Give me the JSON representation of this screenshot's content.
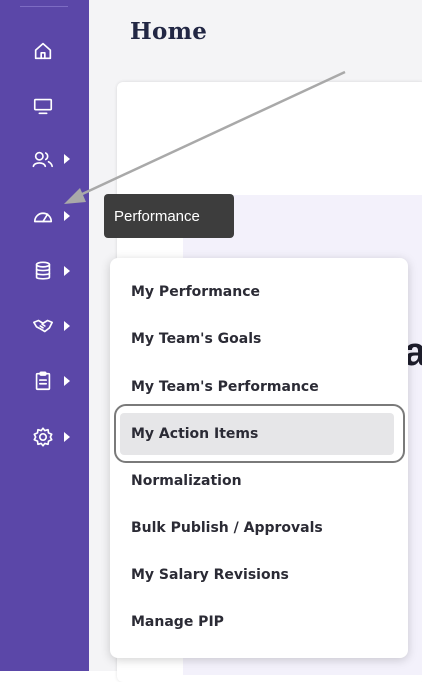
{
  "header": {
    "title": "Home"
  },
  "sidebar": {
    "items": [
      {
        "icon": "home-icon",
        "has_submenu": false
      },
      {
        "icon": "monitor-icon",
        "has_submenu": false
      },
      {
        "icon": "users-icon",
        "has_submenu": true
      },
      {
        "icon": "speedometer-icon",
        "has_submenu": true
      },
      {
        "icon": "database-icon",
        "has_submenu": true
      },
      {
        "icon": "handshake-icon",
        "has_submenu": true
      },
      {
        "icon": "clipboard-icon",
        "has_submenu": true
      },
      {
        "icon": "gear-icon",
        "has_submenu": true
      }
    ]
  },
  "tooltip": {
    "label": "Performance"
  },
  "submenu": {
    "items": [
      "My Performance",
      "My Team's Goals",
      "My Team's Performance",
      "My Action Items",
      "Normalization",
      "Bulk Publish / Approvals",
      "My Salary Revisions",
      "Manage PIP"
    ],
    "selected": "My Action Items"
  },
  "colors": {
    "sidebar": "#5b47a8",
    "tooltip": "#3d3d3d",
    "selected_item": "#e6e6e8",
    "title": "#222744"
  }
}
